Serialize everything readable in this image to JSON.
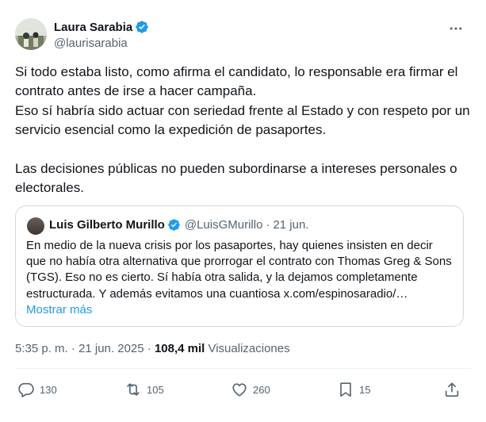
{
  "author": {
    "name": "Laura Sarabia",
    "handle": "@laurisarabia"
  },
  "tweet": {
    "lines": [
      "Si todo estaba listo, como afirma el candidato, lo responsable era firmar el contrato antes de irse a hacer campaña.",
      "Eso sí habría sido actuar con seriedad frente al Estado y con respeto por un servicio esencial como la expedición de pasaportes.",
      "Las decisiones públicas no pueden subordinarse a intereses personales o electorales."
    ]
  },
  "quote": {
    "name": "Luis Gilberto Murillo",
    "handle": "@LuisGMurillo",
    "separator": "·",
    "date": "21 jun.",
    "text": "En medio de la nueva crisis por los pasaportes, hay quienes insisten en decir que no había otra alternativa que prorrogar el contrato con Thomas Greg & Sons (TGS). Eso no es cierto. Sí había otra salida, y la dejamos completamente estructurada. Y además evitamos una cuantiosa x.com/espinosaradio/…",
    "show_more": "Mostrar más"
  },
  "meta": {
    "time_date": "5:35 p. m. · 21 jun. 2025 · ",
    "views_count": "108,4 mil",
    "views_label": " Visualizaciones"
  },
  "actions": {
    "replies": "130",
    "reposts": "105",
    "likes": "260",
    "bookmarks": "15"
  },
  "colors": {
    "verified": "#1d9bf0",
    "secondary_text": "#536471",
    "link": "#1d9bf0"
  }
}
